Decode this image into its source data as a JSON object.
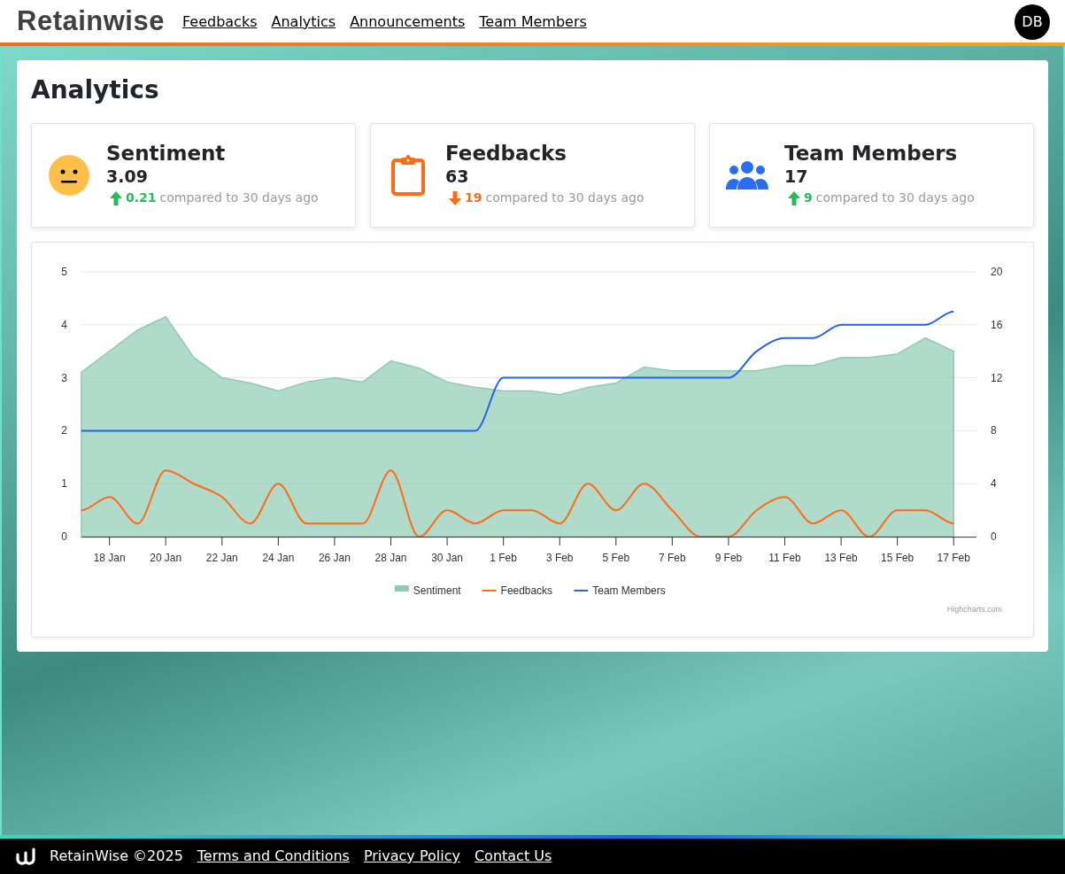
{
  "navbar": {
    "logo": "Retainwise",
    "links": [
      "Feedbacks",
      "Analytics",
      "Announcements",
      "Team Members"
    ],
    "avatar": "DB"
  },
  "page_title": "Analytics",
  "stats": [
    {
      "kind": "sentiment",
      "title": "Sentiment",
      "value": "3.09",
      "increase": true,
      "change": "0.21",
      "note": "compared to 30 days ago"
    },
    {
      "kind": "feedbacks",
      "title": "Feedbacks",
      "value": "63",
      "increase": false,
      "change": "19",
      "note": "compared to 30 days ago"
    },
    {
      "kind": "team",
      "title": "Team Members",
      "value": "17",
      "increase": true,
      "change": "9",
      "note": "compared to 30 days ago"
    }
  ],
  "chart": {
    "credits": "Highcharts.com",
    "chart_data": {
      "type": "line",
      "categories": [
        null,
        "18 Jan",
        null,
        "20 Jan",
        null,
        "22 Jan",
        null,
        "24 Jan",
        null,
        "26 Jan",
        null,
        "28 Jan",
        null,
        "30 Jan",
        null,
        "1 Feb",
        null,
        "3 Feb",
        null,
        "5 Feb",
        null,
        "7 Feb",
        null,
        "9 Feb",
        null,
        "11 Feb",
        null,
        "13 Feb",
        null,
        "15 Feb",
        null,
        "17 Feb"
      ],
      "grid": true,
      "legend": "bottom",
      "ylim": [
        0,
        5
      ],
      "yticks": [
        0,
        1,
        2,
        3,
        4,
        5
      ],
      "y2lim": [
        0,
        20
      ],
      "y2ticks": [
        0,
        4,
        8,
        12,
        16,
        20
      ],
      "series": [
        {
          "name": "Sentiment",
          "type": "area",
          "color": "#8fcbb3",
          "values": [
            3.1,
            3.5,
            3.9,
            4.15,
            3.38,
            3.0,
            2.9,
            2.75,
            2.92,
            3.0,
            2.92,
            3.32,
            3.18,
            2.92,
            2.82,
            2.75,
            2.75,
            2.68,
            2.82,
            2.9,
            3.2,
            3.13,
            3.13,
            3.13,
            3.13,
            3.23,
            3.23,
            3.38,
            3.38,
            3.45,
            3.75,
            3.5
          ]
        },
        {
          "name": "Feedbacks",
          "type": "line",
          "axis": "y2",
          "color": "#ff6a13",
          "values": [
            2,
            3,
            1,
            5,
            4,
            3,
            1,
            4,
            1,
            1,
            1,
            5,
            0,
            2,
            1,
            2,
            2,
            1,
            4,
            2,
            4,
            2,
            0,
            0,
            2,
            3,
            1,
            2,
            0,
            2,
            2,
            1
          ]
        },
        {
          "name": "Team Members",
          "type": "line",
          "axis": "y2",
          "color": "#1f63f0",
          "values": [
            8,
            8,
            8,
            8,
            8,
            8,
            8,
            8,
            8,
            8,
            8,
            8,
            8,
            8,
            8,
            12,
            12,
            12,
            12,
            12,
            12,
            12,
            12,
            12,
            14,
            15,
            15,
            16,
            16,
            16,
            16,
            17
          ]
        }
      ]
    }
  },
  "footer": {
    "brand": "RetainWise ©2025",
    "links": [
      "Terms and Conditions",
      "Privacy Policy",
      "Contact Us"
    ]
  }
}
